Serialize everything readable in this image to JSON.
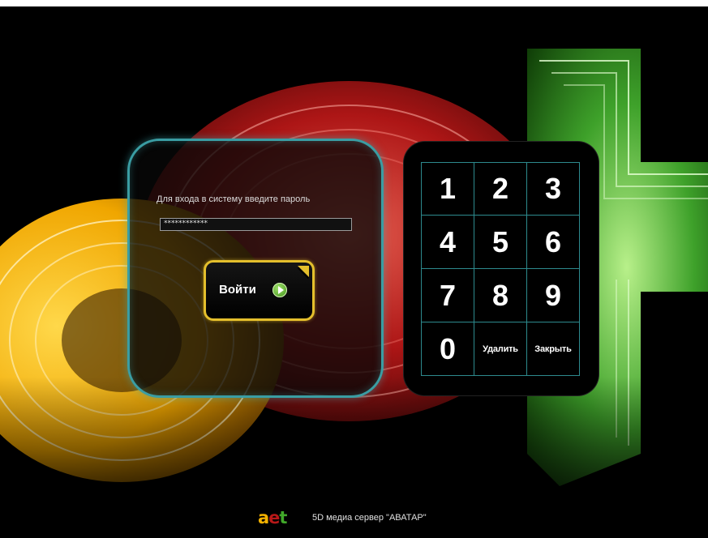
{
  "background": {
    "colors": {
      "yellow": "#f4b200",
      "red": "#b81818",
      "green": "#41a82a",
      "teal_border": "#3a9da3",
      "gold_border": "#e4bf2c"
    }
  },
  "login": {
    "prompt": "Для входа в систему введите пароль",
    "password_value": "************",
    "login_label": "Войти",
    "login_icon": "play-icon"
  },
  "keypad": {
    "keys": [
      "1",
      "2",
      "3",
      "4",
      "5",
      "6",
      "7",
      "8",
      "9",
      "0",
      "Удалить",
      "Закрыть"
    ]
  },
  "footer": {
    "logo_text": "aet",
    "caption": "5D медиа сервер \"АВАТАР\""
  }
}
